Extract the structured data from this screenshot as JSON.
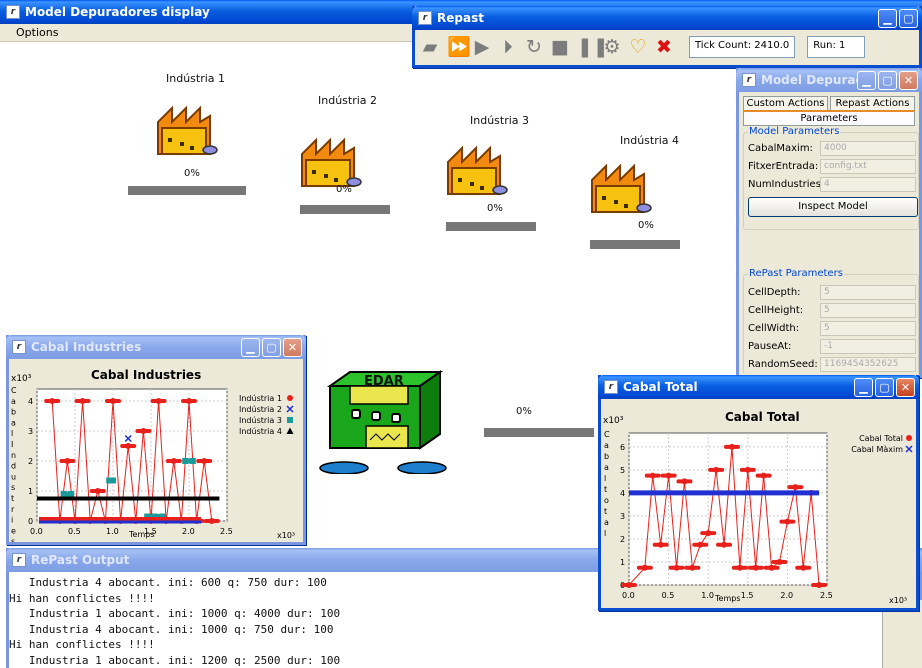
{
  "main_window": {
    "title": "Model Depuradores display",
    "menu": [
      "Options"
    ],
    "industries": [
      {
        "label": "Indústria 1",
        "percent": "0%"
      },
      {
        "label": "Indústria 2",
        "percent": "0%"
      },
      {
        "label": "Indústria 3",
        "percent": "0%"
      },
      {
        "label": "Indústria 4",
        "percent": "0%"
      }
    ],
    "edar": {
      "label": "EDAR",
      "percent": "0%"
    }
  },
  "repast": {
    "title": "Repast",
    "tools": [
      "setup-icon",
      "step-fast-icon",
      "play-icon",
      "step-icon",
      "reset-icon",
      "stop-square-icon",
      "pause-icon",
      "settings-icon",
      "bulb-icon",
      "exit-icon"
    ],
    "tick_count": "Tick Count: 2410.0",
    "run": "Run: 1"
  },
  "params": {
    "title": "Model Depurad...",
    "tabs": [
      "Custom Actions",
      "Repast Actions"
    ],
    "active_tab": "Parameters",
    "model_group": "Model Parameters",
    "model_params": [
      {
        "name": "CabalMaxim:",
        "value": "4000"
      },
      {
        "name": "FitxerEntrada:",
        "value": "config.txt"
      },
      {
        "name": "NumIndustries:",
        "value": "4"
      }
    ],
    "inspect_button": "Inspect Model",
    "repast_group": "RePast Parameters",
    "repast_params": [
      {
        "name": "CellDepth:",
        "value": "5"
      },
      {
        "name": "CellHeight:",
        "value": "5"
      },
      {
        "name": "CellWidth:",
        "value": "5"
      },
      {
        "name": "PauseAt:",
        "value": "-1"
      },
      {
        "name": "RandomSeed:",
        "value": "1169454352625"
      }
    ]
  },
  "cabal_industries": {
    "window_title": "Cabal Industries",
    "chart_title": "Cabal Industries",
    "ylabel": "Cabal Industries",
    "xlabel": "Temps",
    "y_multiplier": "x10³",
    "x_multiplier": "x10³"
  },
  "cabal_total": {
    "window_title": "Cabal Total",
    "chart_title": "Cabal Total",
    "ylabel": "Cabal total",
    "xlabel": "Temps",
    "y_multiplier": "x10³",
    "x_multiplier": "x10³"
  },
  "output": {
    "title": "RePast Output",
    "lines": [
      "   Industria 4 abocant. ini: 600 q: 750 dur: 100",
      "Hi han conflictes !!!!",
      "   Industria 1 abocant. ini: 1000 q: 4000 dur: 100",
      "   Industria 4 abocant. ini: 1000 q: 750 dur: 100",
      "Hi han conflictes !!!!",
      "   Industria 1 abocant. ini: 1200 q: 2500 dur: 100"
    ]
  },
  "chart_data": [
    {
      "type": "line",
      "title": "Cabal Industries",
      "xlabel": "Temps",
      "ylabel": "Cabal Industries",
      "xlim": [
        0,
        2.5
      ],
      "ylim": [
        0,
        4.4
      ],
      "xticks": [
        "0.0",
        "0.5",
        "1.0",
        "1.5",
        "2.0",
        "2.5"
      ],
      "yticks": [
        "0",
        "1",
        "2",
        "3",
        "4"
      ],
      "legend_position": "right",
      "series": [
        {
          "name": "Indústria 1",
          "marker": "circle",
          "color": "#e8201c",
          "x": [
            0.2,
            0.3,
            0.4,
            0.5,
            0.6,
            0.7,
            0.8,
            0.9,
            1.0,
            1.1,
            1.2,
            1.3,
            1.4,
            1.5,
            1.6,
            1.7,
            1.8,
            1.9,
            2.0,
            2.1,
            2.2,
            2.3
          ],
          "y": [
            4.0,
            0,
            2.0,
            0,
            4.0,
            0,
            1.0,
            0,
            4.0,
            0,
            2.5,
            0,
            3.0,
            0,
            4.0,
            0,
            2.0,
            0,
            4.0,
            0,
            2.0,
            0
          ]
        },
        {
          "name": "Indústria 2",
          "marker": "x",
          "color": "#2030d0",
          "x": [
            1.2
          ],
          "y": [
            2.75
          ]
        },
        {
          "name": "Indústria 3",
          "marker": "square",
          "color": "#1a9a98",
          "x": [
            0.35,
            0.45,
            0.95,
            1.0,
            1.45,
            1.55,
            1.65,
            1.95,
            2.05
          ],
          "y": [
            0.9,
            0.9,
            1.35,
            1.35,
            0.15,
            0.15,
            0.15,
            2.0,
            2.0
          ]
        },
        {
          "name": "Indústria 4",
          "marker": "triangle",
          "color": "#000000",
          "x": [
            0.0,
            2.4
          ],
          "y": [
            0.75,
            0.75
          ]
        }
      ]
    },
    {
      "type": "line",
      "title": "Cabal Total",
      "xlabel": "Temps",
      "ylabel": "Cabal total",
      "xlim": [
        0,
        2.5
      ],
      "ylim": [
        0,
        6.6
      ],
      "xticks": [
        "0.0",
        "0.5",
        "1.0",
        "1.5",
        "2.0",
        "2.5"
      ],
      "yticks": [
        "0",
        "1",
        "2",
        "3",
        "4",
        "5",
        "6"
      ],
      "legend_position": "top-right",
      "series": [
        {
          "name": "Cabal Total",
          "marker": "circle",
          "color": "#e8201c",
          "x": [
            0.0,
            0.2,
            0.3,
            0.4,
            0.5,
            0.6,
            0.7,
            0.8,
            0.9,
            1.0,
            1.1,
            1.2,
            1.3,
            1.4,
            1.5,
            1.6,
            1.7,
            1.8,
            1.9,
            2.0,
            2.1,
            2.2,
            2.3,
            2.4
          ],
          "y": [
            0.0,
            0.75,
            4.75,
            1.75,
            4.75,
            0.75,
            4.5,
            0.75,
            1.75,
            2.25,
            5.0,
            1.75,
            6.0,
            0.75,
            5.0,
            0.75,
            4.75,
            0.75,
            1.0,
            2.75,
            4.25,
            0.75,
            4.0,
            0.0
          ]
        },
        {
          "name": "Cabal Màxim",
          "marker": "x",
          "color": "#2030d0",
          "x": [
            0.0,
            2.4
          ],
          "y": [
            4.0,
            4.0
          ]
        }
      ]
    }
  ]
}
